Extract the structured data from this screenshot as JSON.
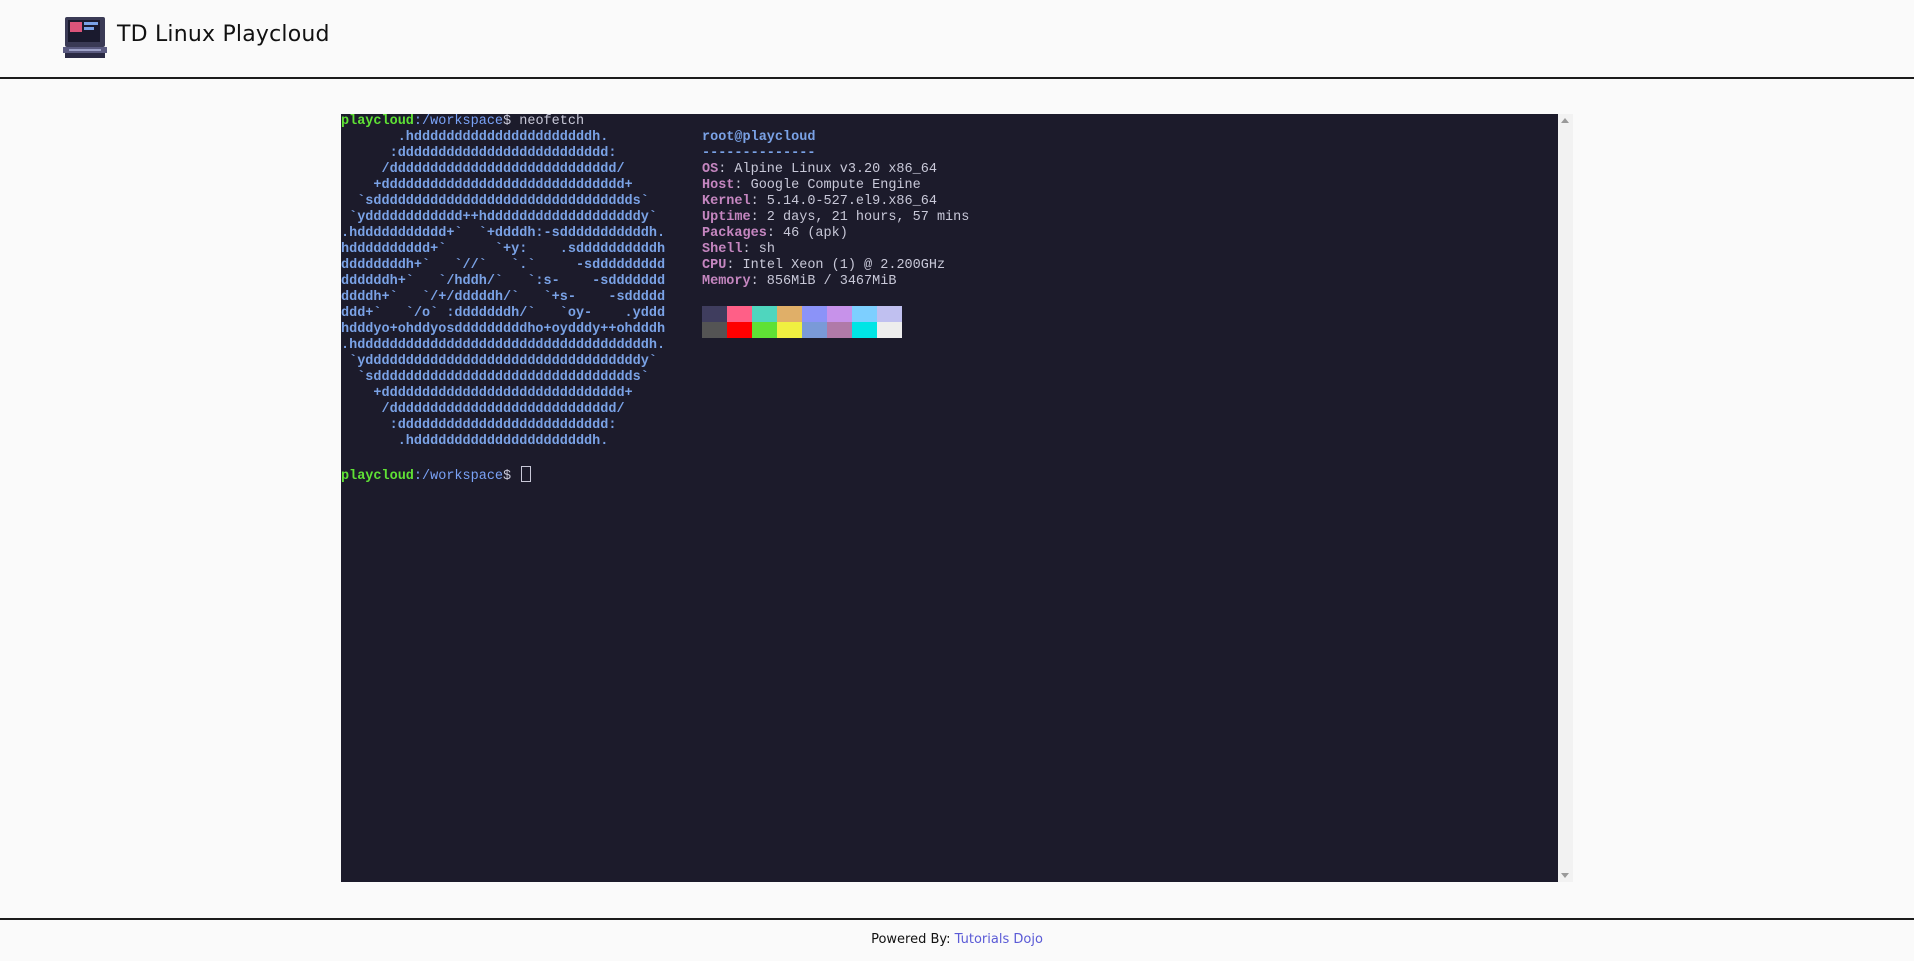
{
  "header": {
    "title": "TD Linux Playcloud",
    "logo_icon": "retro-computer-icon"
  },
  "terminal": {
    "prompt": {
      "host": "playcloud",
      "path": ":/workspace",
      "dollar": "$ "
    },
    "command": "neofetch",
    "ascii_art": [
      "       .hddddddddddddddddddddddh.",
      "      :dddddddddddddddddddddddddd:",
      "     /dddddddddddddddddddddddddddd/",
      "    +dddddddddddddddddddddddddddddd+",
      "  `sdddddddddddddddddddddddddddddddds`",
      " `ydddddddddddd++hdddddddddddddddddddy`",
      ".hddddddddddd+`  `+ddddh:-sdddddddddddh.",
      "hdddddddddd+`      `+y:    .sddddddddddh",
      "ddddddddh+`   `//`   `.`     -sddddddddd",
      "ddddddh+`   `/hddh/`   `:s-    -sddddddd",
      "ddddh+`   `/+/dddddh/`   `+s-    -sddddd",
      "ddd+`   `/o` :dddddddh/`   `oy-    .yddd",
      "hdddyo+ohddyosdddddddddho+oydddy++ohdddh",
      ".hddddddddddddddddddddddddddddddddddddh.",
      " `yddddddddddddddddddddddddddddddddddy`",
      "  `sdddddddddddddddddddddddddddddddds`",
      "    +dddddddddddddddddddddddddddddd+",
      "     /dddddddddddddddddddddddddddd/",
      "      :dddddddddddddddddddddddddd:",
      "       .hddddddddddddddddddddddh."
    ],
    "info": {
      "title": "root@playcloud",
      "separator": "--------------",
      "rows": [
        {
          "key": "OS",
          "value": ": Alpine Linux v3.20 x86_64"
        },
        {
          "key": "Host",
          "value": ": Google Compute Engine"
        },
        {
          "key": "Kernel",
          "value": ": 5.14.0-527.el9.x86_64"
        },
        {
          "key": "Uptime",
          "value": ": 2 days, 21 hours, 57 mins"
        },
        {
          "key": "Packages",
          "value": ": 46 (apk)"
        },
        {
          "key": "Shell",
          "value": ": sh"
        },
        {
          "key": "CPU",
          "value": ": Intel Xeon (1) @ 2.200GHz"
        },
        {
          "key": "Memory",
          "value": ": 856MiB / 3467MiB"
        }
      ]
    },
    "palette": {
      "row1": [
        "#3f3d5e",
        "#ff5f87",
        "#4fd6be",
        "#e0af68",
        "#8b93f8",
        "#c792ea",
        "#7dcfff",
        "#c0c0f0"
      ],
      "row2": [
        "#545454",
        "#ff0000",
        "#5fe135",
        "#f0f040",
        "#7a9ad8",
        "#b07aa8",
        "#00e5e5",
        "#ededed"
      ]
    }
  },
  "footer": {
    "prefix": "Powered By: ",
    "link": "Tutorials Dojo"
  }
}
